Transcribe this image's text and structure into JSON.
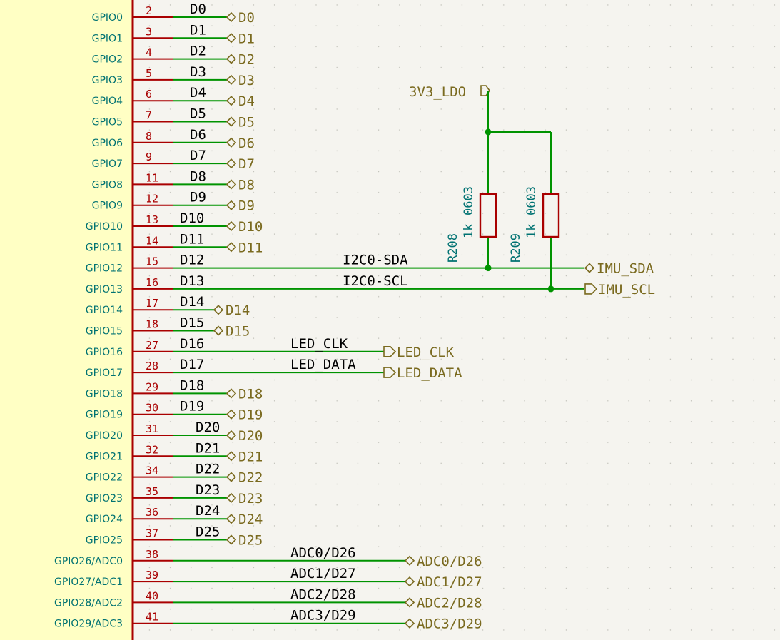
{
  "colors": {
    "background": "#f5f4ef",
    "grid": "#bdbdb5",
    "wire": "#009300",
    "pin": "#a90000",
    "symbol_body": "#ffffc4",
    "pin_name": "#007272",
    "pin_number": "#a90000",
    "net_label": "#000000",
    "global_label": "#7a6a1f",
    "junction": "#009300"
  },
  "pins": [
    {
      "name": "GPIO0",
      "number": "2",
      "net": "D0",
      "glabel": "D0"
    },
    {
      "name": "GPIO1",
      "number": "3",
      "net": "D1",
      "glabel": "D1"
    },
    {
      "name": "GPIO2",
      "number": "4",
      "net": "D2",
      "glabel": "D2"
    },
    {
      "name": "GPIO3",
      "number": "5",
      "net": "D3",
      "glabel": "D3"
    },
    {
      "name": "GPIO4",
      "number": "6",
      "net": "D4",
      "glabel": "D4"
    },
    {
      "name": "GPIO5",
      "number": "7",
      "net": "D5",
      "glabel": "D5"
    },
    {
      "name": "GPIO6",
      "number": "8",
      "net": "D6",
      "glabel": "D6"
    },
    {
      "name": "GPIO7",
      "number": "9",
      "net": "D7",
      "glabel": "D7"
    },
    {
      "name": "GPIO8",
      "number": "11",
      "net": "D8",
      "glabel": "D8"
    },
    {
      "name": "GPIO9",
      "number": "12",
      "net": "D9",
      "glabel": "D9"
    },
    {
      "name": "GPIO10",
      "number": "13",
      "net": "D10",
      "glabel": "D10"
    },
    {
      "name": "GPIO11",
      "number": "14",
      "net": "D11",
      "glabel": "D11"
    },
    {
      "name": "GPIO12",
      "number": "15",
      "net": "D12",
      "glabel": "IMU_SDA",
      "net2": "I2C0-SDA"
    },
    {
      "name": "GPIO13",
      "number": "16",
      "net": "D13",
      "glabel": "IMU_SCL",
      "net2": "I2C0-SCL"
    },
    {
      "name": "GPIO14",
      "number": "17",
      "net": "D14",
      "glabel": "D14"
    },
    {
      "name": "GPIO15",
      "number": "18",
      "net": "D15",
      "glabel": "D15"
    },
    {
      "name": "GPIO16",
      "number": "27",
      "net": "D16",
      "glabel": "LED_CLK",
      "net2": "LED_CLK"
    },
    {
      "name": "GPIO17",
      "number": "28",
      "net": "D17",
      "glabel": "LED_DATA",
      "net2": "LED_DATA"
    },
    {
      "name": "GPIO18",
      "number": "29",
      "net": "D18",
      "glabel": "D18"
    },
    {
      "name": "GPIO19",
      "number": "30",
      "net": "D19",
      "glabel": "D19"
    },
    {
      "name": "GPIO20",
      "number": "31",
      "net": "D20",
      "glabel": "D20"
    },
    {
      "name": "GPIO21",
      "number": "32",
      "net": "D21",
      "glabel": "D21"
    },
    {
      "name": "GPIO22",
      "number": "34",
      "net": "D22",
      "glabel": "D22"
    },
    {
      "name": "GPIO23",
      "number": "35",
      "net": "D23",
      "glabel": "D23"
    },
    {
      "name": "GPIO24",
      "number": "36",
      "net": "D24",
      "glabel": "D24"
    },
    {
      "name": "GPIO25",
      "number": "37",
      "net": "D25",
      "glabel": "D25"
    },
    {
      "name": "GPIO26/ADC0",
      "number": "38",
      "net": "ADC0/D26",
      "glabel": "ADC0/D26"
    },
    {
      "name": "GPIO27/ADC1",
      "number": "39",
      "net": "ADC1/D27",
      "glabel": "ADC1/D27"
    },
    {
      "name": "GPIO28/ADC2",
      "number": "40",
      "net": "ADC2/D28",
      "glabel": "ADC2/D28"
    },
    {
      "name": "GPIO29/ADC3",
      "number": "41",
      "net": "ADC3/D29",
      "glabel": "ADC3/D29"
    }
  ],
  "power": {
    "label": "3V3_LDO"
  },
  "resistors": [
    {
      "ref": "R208",
      "value": "1k",
      "package": "0603"
    },
    {
      "ref": "R209",
      "value": "1k",
      "package": "0603"
    }
  ]
}
